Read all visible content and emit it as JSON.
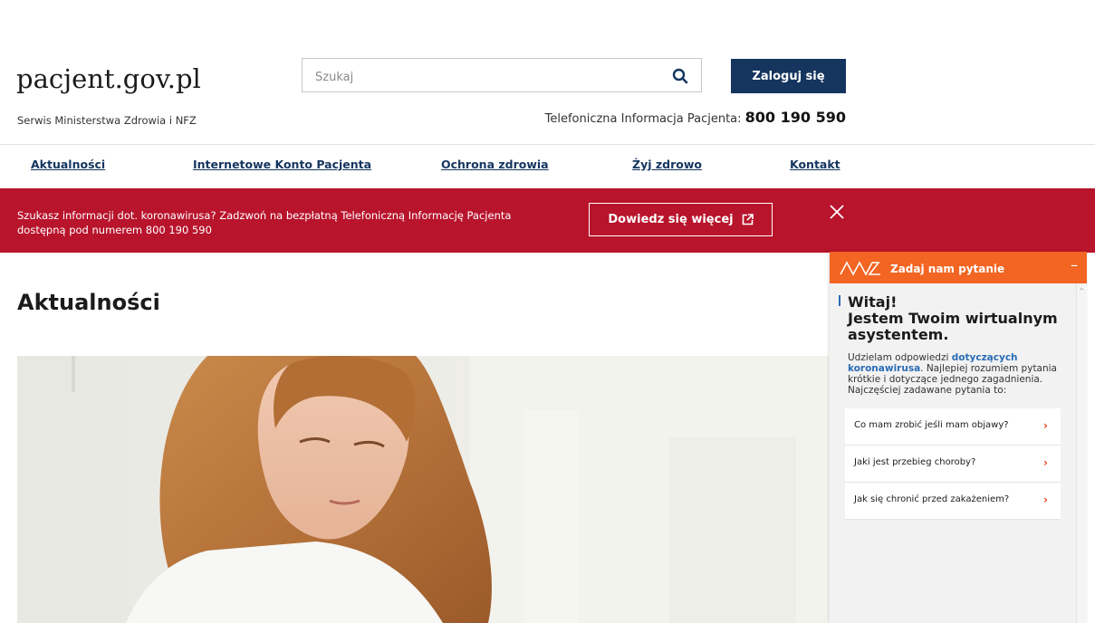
{
  "header": {
    "logo": "pacjent.gov.pl",
    "tagline": "Serwis Ministerstwa Zdrowia i NFZ",
    "search_placeholder": "Szukaj",
    "login_label": "Zaloguj się",
    "phone_label": "Telefoniczna Informacja Pacjenta:",
    "phone_number": "800 190 590"
  },
  "nav": {
    "items": [
      "Aktualności",
      "Internetowe Konto Pacjenta",
      "Ochrona zdrowia",
      "Żyj zdrowo",
      "Kontakt"
    ]
  },
  "banner": {
    "text": "Szukasz informacji dot. koronawirusa? Zadzwoń na bezpłatną Telefoniczną Informację Pacjenta dostępną pod numerem 800 190 590",
    "button_label": "Dowiedz się więcej",
    "color": "#b8142c"
  },
  "main": {
    "title": "Aktualności"
  },
  "chat": {
    "header_title": "Zadaj nam pytanie",
    "minimize": "–",
    "greeting_line1": "Witaj!",
    "greeting_line2": "Jestem Twoim wirtualnym asystentem.",
    "intro_before": "Udzielam odpowiedzi",
    "intro_highlight": "dotyczących koronawirusa",
    "intro_after": ". Najlepiej rozumiem pytania krótkie i dotyczące jednego zagadnienia. Najczęściej zadawane pytania to:",
    "faq": [
      "Co mam zrobić jeśli mam objawy?",
      "Jaki jest przebieg choroby?",
      "Jak się chronić przed zakażeniem?"
    ],
    "accent": "#f26522"
  },
  "colors": {
    "navy": "#15355f",
    "link": "#15355f"
  }
}
